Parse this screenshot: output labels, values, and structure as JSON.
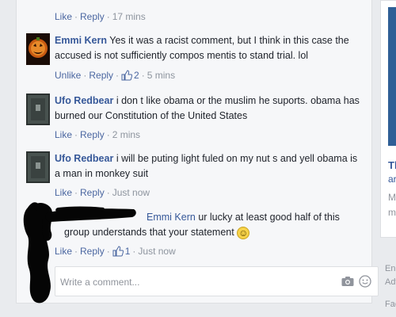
{
  "top_actions": {
    "like": "Like",
    "reply": "Reply",
    "time": "17 mins"
  },
  "comments": [
    {
      "author": "Emmi Kern",
      "text": "Yes it was a racist comment, but I think in this case the accused is not sufficiently compos mentis to stand trial. lol",
      "like_label": "Unlike",
      "reply_label": "Reply",
      "likes": "2",
      "time": "5 mins"
    },
    {
      "author": "Ufo Redbear",
      "text": "i don t like obama or the muslim he suports. obama has burned our Constitution of the United States",
      "like_label": "Like",
      "reply_label": "Reply",
      "time": "2 mins"
    },
    {
      "author": "Ufo Redbear",
      "text": "i will be puting light fuled on my nut s and yell obama is a man in monkey suit",
      "like_label": "Like",
      "reply_label": "Reply",
      "time": "Just now"
    },
    {
      "author": "Emmi Kern",
      "text": "ur lucky at least good half of this group understands that your statement",
      "emoji": "☺",
      "like_label": "Like",
      "reply_label": "Reply",
      "likes": "1",
      "time": "Just now"
    }
  ],
  "composer": {
    "placeholder": "Write a comment..."
  },
  "sidebar": {
    "fragments": [
      "Th",
      "ar",
      "Mo",
      "me"
    ],
    "footer": [
      "Eng",
      "Adv",
      "Fac"
    ]
  },
  "colors": {
    "link": "#365899",
    "action": "#4b67a1",
    "meta": "#8d949e",
    "background": "#e9ebee"
  }
}
